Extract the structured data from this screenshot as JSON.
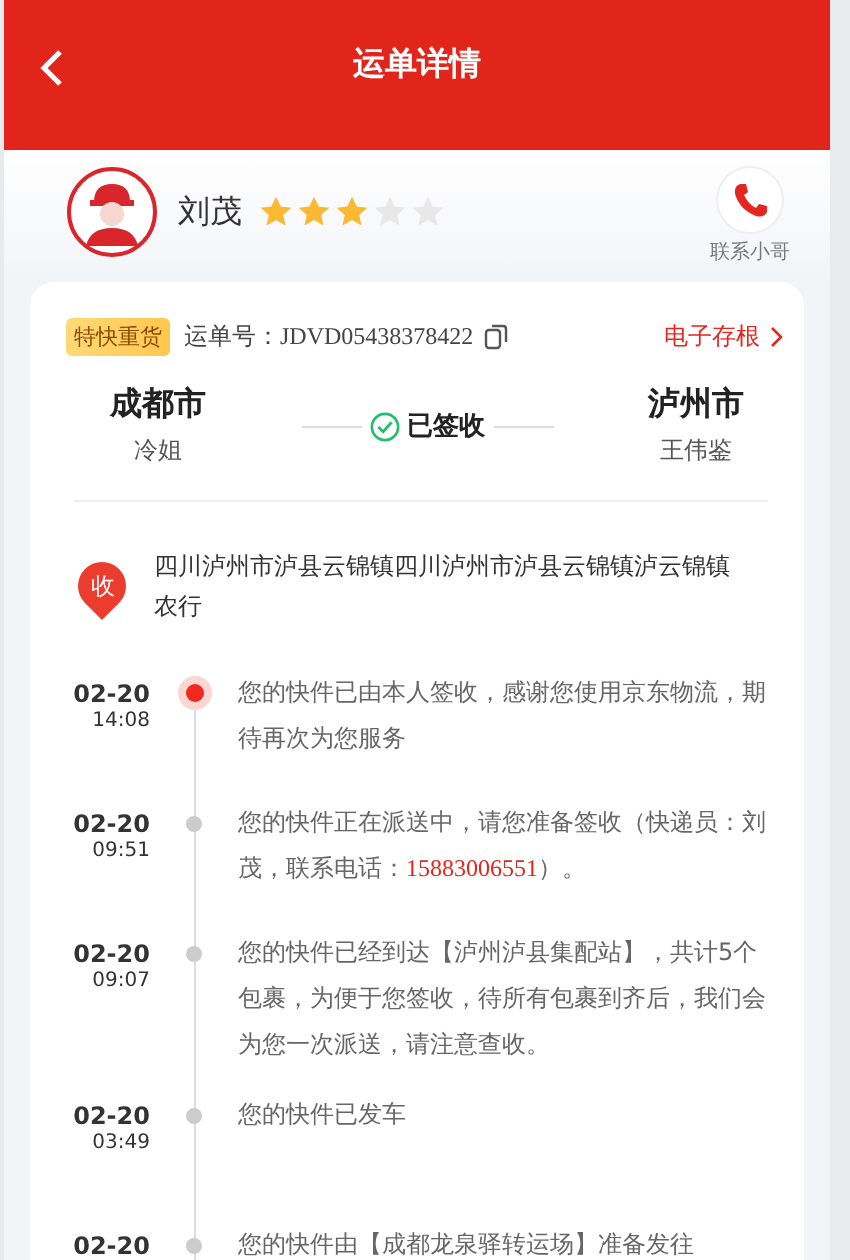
{
  "header": {
    "title": "运单详情"
  },
  "courier": {
    "name": "刘茂",
    "stars": 3,
    "contact_label": "联系小哥"
  },
  "waybill": {
    "tag": "特快重货",
    "number_label": "运单号：",
    "number": "JDVD05438378422",
    "stub_link": "电子存根"
  },
  "route": {
    "from_city": "成都市",
    "from_person": "冷姐",
    "status": "已签收",
    "to_city": "泸州市",
    "to_person": "王伟鉴"
  },
  "address": {
    "badge": "收",
    "text": "四川泸州市泸县云锦镇四川泸州市泸县云锦镇泸云锦镇农行"
  },
  "events": [
    {
      "date": "02-20",
      "time": "14:08",
      "current": true,
      "parts": [
        {
          "kind": "plain",
          "text": "您的快件已由本人签收，感谢您使用京东物流，期待再次为您服务"
        }
      ]
    },
    {
      "date": "02-20",
      "time": "09:51",
      "current": false,
      "parts": [
        {
          "kind": "plain",
          "text": "您的快件正在派送中，请您准备签收（快递员：刘茂，联系电话："
        },
        {
          "kind": "phone",
          "text": "15883006551"
        },
        {
          "kind": "plain",
          "text": "）。"
        }
      ]
    },
    {
      "date": "02-20",
      "time": "09:07",
      "current": false,
      "parts": [
        {
          "kind": "plain",
          "text": "您的快件已经到达【泸州泸县集配站】，共计5个包裹，为便于您签收，待所有包裹到齐后，我们会为您一次派送，请注意查收。"
        }
      ]
    },
    {
      "date": "02-20",
      "time": "03:49",
      "current": false,
      "parts": [
        {
          "kind": "plain",
          "text": "您的快件已发车"
        }
      ]
    },
    {
      "date": "02-20",
      "current": false,
      "parts": [
        {
          "kind": "plain",
          "text": "您的快件由【成都龙泉驿转运场】准备发往"
        }
      ]
    }
  ]
}
